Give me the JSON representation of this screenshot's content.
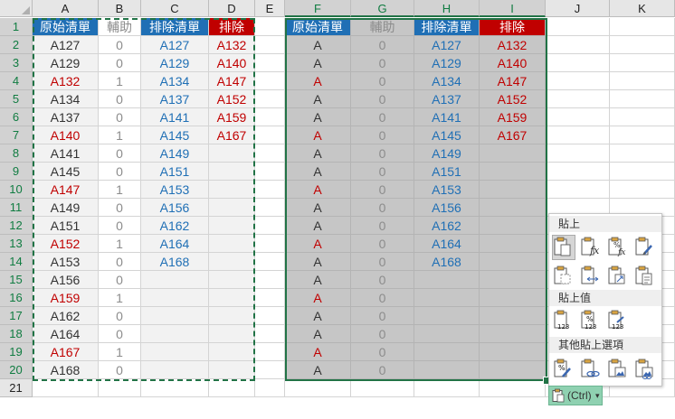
{
  "columns": [
    "A",
    "B",
    "C",
    "D",
    "E",
    "F",
    "G",
    "H",
    "I",
    "J",
    "K"
  ],
  "selected_columns": [
    "F",
    "G",
    "H",
    "I"
  ],
  "rows": [
    "1",
    "2",
    "3",
    "4",
    "5",
    "6",
    "7",
    "8",
    "9",
    "10",
    "11",
    "12",
    "13",
    "14",
    "15",
    "16",
    "17",
    "18",
    "19",
    "20",
    "21"
  ],
  "selected_rows": [
    "1",
    "2",
    "3",
    "4",
    "5",
    "6",
    "7",
    "8",
    "9",
    "10",
    "11",
    "12",
    "13",
    "14",
    "15",
    "16",
    "17",
    "18",
    "19",
    "20"
  ],
  "colors": {
    "header_blue": "#1f6fb5",
    "header_red": "#c00000",
    "text_black": "#333333",
    "text_red": "#c00000",
    "text_blue": "#1f6fb5",
    "text_aux": "#8c8c8c",
    "selection_green": "#217346"
  },
  "headers": {
    "A": "原始清單",
    "B": "輔助",
    "C": "排除清單",
    "D": "排除",
    "F": "原始清單",
    "G": "輔助",
    "H": "排除清單",
    "I": "排除"
  },
  "col_A": [
    "A127",
    "A129",
    "A132",
    "A134",
    "A137",
    "A140",
    "A141",
    "A145",
    "A147",
    "A149",
    "A151",
    "A152",
    "A153",
    "A156",
    "A159",
    "A162",
    "A164",
    "A167",
    "A168"
  ],
  "col_A_red": [
    false,
    false,
    true,
    false,
    false,
    true,
    false,
    false,
    true,
    false,
    false,
    true,
    false,
    false,
    true,
    false,
    false,
    true,
    false
  ],
  "col_B": [
    "0",
    "0",
    "1",
    "0",
    "0",
    "1",
    "0",
    "0",
    "1",
    "0",
    "0",
    "1",
    "0",
    "0",
    "1",
    "0",
    "0",
    "1",
    "0"
  ],
  "col_C": [
    "A127",
    "A129",
    "A134",
    "A137",
    "A141",
    "A145",
    "A149",
    "A151",
    "A153",
    "A156",
    "A162",
    "A164",
    "A168"
  ],
  "col_D": [
    "A132",
    "A140",
    "A147",
    "A152",
    "A159",
    "A167"
  ],
  "col_F": [
    "A",
    "A",
    "A",
    "A",
    "A",
    "A",
    "A",
    "A",
    "A",
    "A",
    "A",
    "A",
    "A",
    "A",
    "A",
    "A",
    "A",
    "A",
    "A"
  ],
  "col_G": [
    "0",
    "0",
    "0",
    "0",
    "0",
    "0",
    "0",
    "0",
    "0",
    "0",
    "0",
    "0",
    "0",
    "0",
    "0",
    "0",
    "0",
    "0",
    "0"
  ],
  "col_H": [
    "A127",
    "A129",
    "A134",
    "A137",
    "A141",
    "A145",
    "A149",
    "A151",
    "A153",
    "A156",
    "A162",
    "A164",
    "A168"
  ],
  "col_I": [
    "A132",
    "A140",
    "A147",
    "A152",
    "A159",
    "A167"
  ],
  "paste_menu": {
    "section_paste": "貼上",
    "section_values": "貼上值",
    "section_other": "其他貼上選項",
    "paste_icons": [
      "paste-icon",
      "paste-formulas-icon",
      "paste-formulas-number-format-icon",
      "paste-keep-source-formatting-icon",
      "paste-no-borders-icon",
      "paste-keep-column-widths-icon",
      "paste-transpose-icon",
      "paste-merge-format-icon"
    ],
    "values_icons": [
      "paste-values-icon",
      "paste-values-number-format-icon",
      "paste-values-source-format-icon"
    ],
    "other_icons": [
      "paste-formatting-icon",
      "paste-link-icon",
      "paste-picture-icon",
      "paste-linked-picture-icon"
    ]
  },
  "ctrl_button": {
    "label": "(Ctrl)",
    "arrow": "▾",
    "icon": "clipboard-icon"
  }
}
